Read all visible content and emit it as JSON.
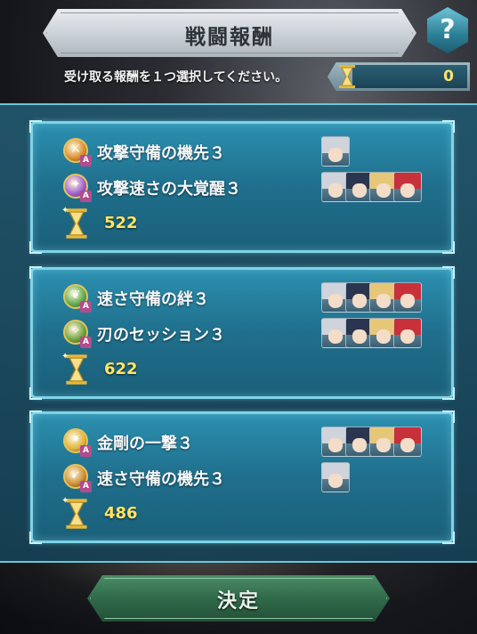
{
  "header": {
    "title": "戦闘報酬",
    "help_label": "?",
    "instruction": "受け取る報酬を１つ選択してください。",
    "counter_value": "0",
    "counter_icon": "hourglass-icon"
  },
  "rewards": [
    {
      "skills": [
        {
          "name": "攻撃守備の機先３",
          "icon": "skill-attack-defense-icon",
          "icon_color": "#d98b2b",
          "glyph": "⚔",
          "slot": "A",
          "portrait_count": 1
        },
        {
          "name": "攻撃速さの大覚醒３",
          "icon": "skill-attack-speed-awakening-icon",
          "icon_color": "#9c5bd1",
          "glyph": "✦",
          "slot": "A",
          "portrait_count": 4
        }
      ],
      "feathers": "522"
    },
    {
      "skills": [
        {
          "name": "速さ守備の絆３",
          "icon": "skill-speed-defense-bond-icon",
          "icon_color": "#5aa84a",
          "glyph": "❦",
          "slot": "A",
          "portrait_count": 4
        },
        {
          "name": "刃のセッション３",
          "icon": "skill-blade-session-icon",
          "icon_color": "#6aa03a",
          "glyph": "✧",
          "slot": "A",
          "portrait_count": 4
        }
      ],
      "feathers": "622"
    },
    {
      "skills": [
        {
          "name": "金剛の一撃３",
          "icon": "skill-armored-blow-icon",
          "icon_color": "#e0b23a",
          "glyph": "✷",
          "slot": "A",
          "portrait_count": 4
        },
        {
          "name": "速さ守備の機先３",
          "icon": "skill-speed-defense-icon",
          "icon_color": "#c98a2e",
          "glyph": "➹",
          "slot": "A",
          "portrait_count": 1
        }
      ],
      "feathers": "486"
    }
  ],
  "portrait_palette": [
    {
      "hair": "#cfd3dc"
    },
    {
      "hair": "#2a3550"
    },
    {
      "hair": "#e6c777"
    },
    {
      "hair": "#c8303a"
    }
  ],
  "footer": {
    "decide_label": "決定"
  }
}
